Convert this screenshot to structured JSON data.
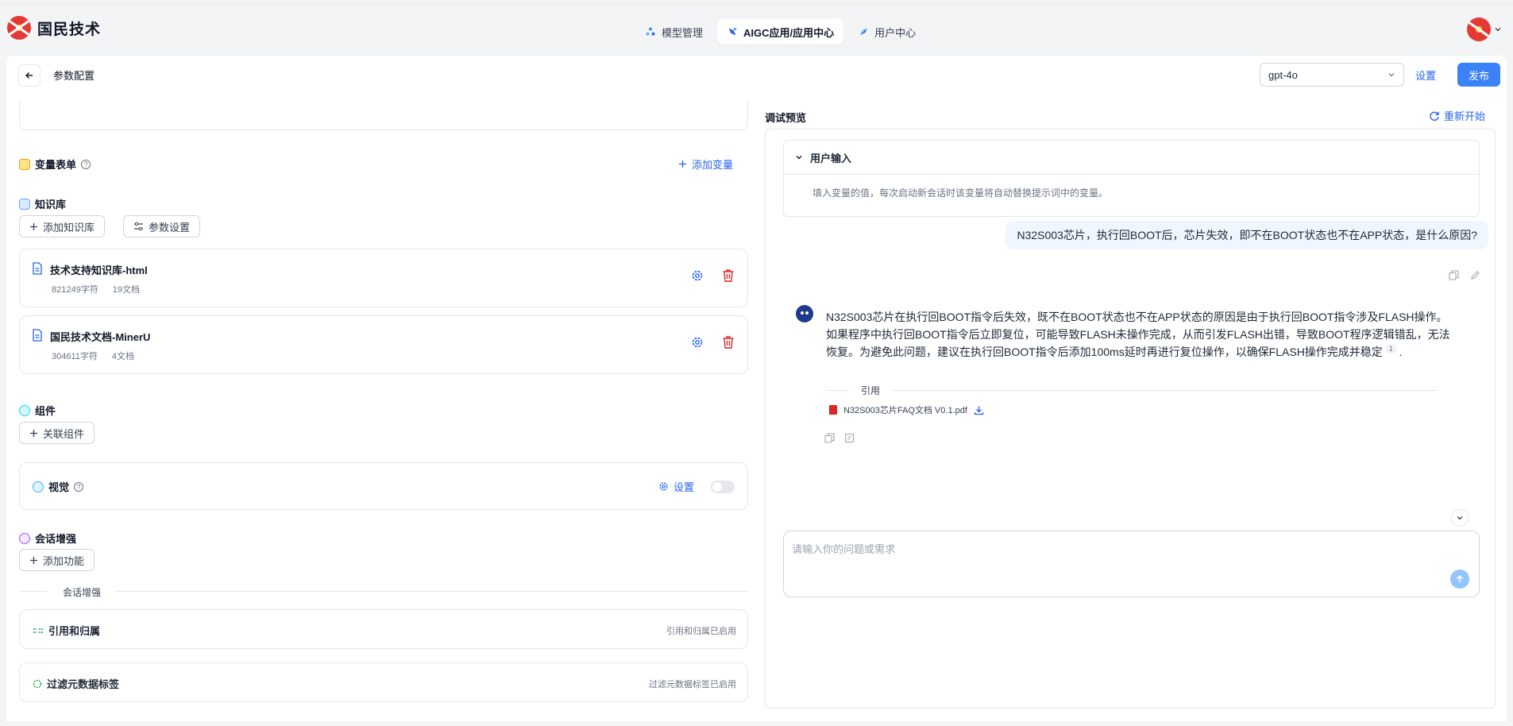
{
  "brand": {
    "name": "国民技术"
  },
  "nav": {
    "tabs": [
      {
        "label": "模型管理",
        "icon": "model-icon"
      },
      {
        "label": "AIGC应用/应用中心",
        "icon": "app-icon",
        "active": true
      },
      {
        "label": "用户中心",
        "icon": "user-icon"
      }
    ]
  },
  "header": {
    "title": "参数配置",
    "model_value": "gpt-4o",
    "settings_label": "设置",
    "publish_label": "发布"
  },
  "variables": {
    "title": "变量表单",
    "add_label": "添加变量"
  },
  "knowledge": {
    "title": "知识库",
    "add_label": "添加知识库",
    "params_label": "参数设置",
    "items": [
      {
        "name": "技术支持知识库-html",
        "chars": "821249字符",
        "docs": "19文档"
      },
      {
        "name": "国民技术文档-MinerU",
        "chars": "304611字符",
        "docs": "4文档"
      }
    ]
  },
  "components": {
    "title": "组件",
    "link_label": "关联组件",
    "vision": {
      "title": "视觉",
      "settings_label": "设置",
      "enabled": false
    }
  },
  "enhance": {
    "title": "会话增强",
    "add_label": "添加功能",
    "divider_label": "会话增强",
    "features": [
      {
        "name": "引用和归属",
        "status": "引用和归属已启用"
      },
      {
        "name": "过滤元数据标签",
        "status": "过滤元数据标签已启用"
      }
    ]
  },
  "preview": {
    "title": "调试预览",
    "restart_label": "重新开始",
    "user_input_title": "用户输入",
    "user_input_hint": "填入变量的值，每次启动新会话时该变量将自动替换提示词中的变量。",
    "user_message": "N32S003芯片，执行回BOOT后，芯片失效，即不在BOOT状态也不在APP状态，是什么原因?",
    "bot_message": "N32S003芯片在执行回BOOT指令后失效，既不在BOOT状态也不在APP状态的原因是由于执行回BOOT指令涉及FLASH操作。如果程序中执行回BOOT指令后立即复位，可能导致FLASH未操作完成，从而引发FLASH出错，导致BOOT程序逻辑错乱，无法恢复。为避免此问题，建议在执行回BOOT指令后添加100ms延时再进行复位操作，以确保FLASH操作完成并稳定",
    "bot_citation_index": "1",
    "bot_message_end": ".",
    "citation_label": "引用",
    "citation_file": "N32S003芯片FAQ文档 V0.1.pdf",
    "input_placeholder": "请输入你的问题或需求"
  },
  "colors": {
    "accent": "#3b82f6",
    "link": "#2563eb",
    "danger": "#dc2626"
  }
}
